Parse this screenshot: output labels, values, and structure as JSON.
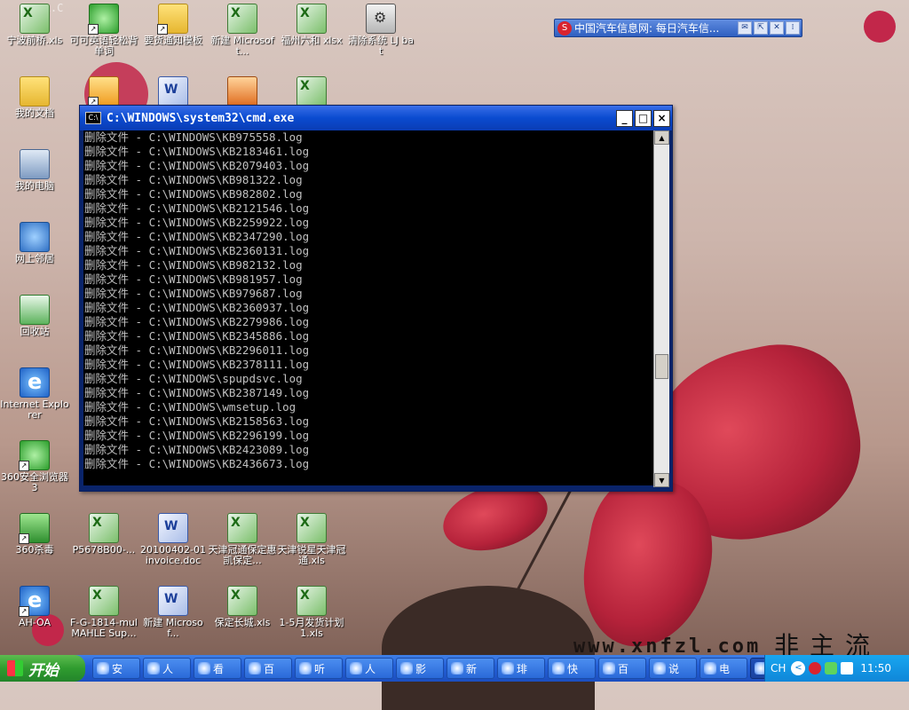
{
  "desktop": {
    "watermark_url": "www.xnfzl.com",
    "watermark_cjk": "非主流",
    "watermark_topleft": "WYRL.C",
    "icons": [
      {
        "label": "宁波前桥.xls",
        "icon": "excel-file-icon"
      },
      {
        "label": "可可英语轻松背单词",
        "icon": "app-shortcut-icon"
      },
      {
        "label": "要货通知模板",
        "icon": "folder-icon"
      },
      {
        "label": "新建 Microsoft...",
        "icon": "excel-file-icon"
      },
      {
        "label": "福州六和 xlsx",
        "icon": "excel-file-icon"
      },
      {
        "label": "清除系统 LJ bat",
        "icon": "batch-file-icon"
      },
      {
        "label": "我的文档",
        "icon": "my-documents-icon"
      },
      {
        "label": "我的电脑",
        "icon": "my-computer-icon"
      },
      {
        "label": "网上邻居",
        "icon": "network-icon"
      },
      {
        "label": "回收站",
        "icon": "recycle-bin-icon"
      },
      {
        "label": "Internet Explorer",
        "icon": "ie-icon"
      },
      {
        "label": "360安全浏览器 3",
        "icon": "browser-360-icon"
      },
      {
        "label": "360杀毒",
        "icon": "antivirus-360-icon"
      },
      {
        "label": "P5678B00-...",
        "icon": "excel-file-icon"
      },
      {
        "label": "20100402-01 invoice.doc",
        "icon": "word-file-icon"
      },
      {
        "label": "天津冠通保定惠凯保定...",
        "icon": "excel-file-icon"
      },
      {
        "label": "天津锐星天津冠通.xls",
        "icon": "excel-file-icon"
      },
      {
        "label": "AH-OA",
        "icon": "ie-shortcut-icon"
      },
      {
        "label": "F-G-1814-mul MAHLE Sup...",
        "icon": "excel-file-icon"
      },
      {
        "label": "新建 Microsof...",
        "icon": "word-file-icon"
      },
      {
        "label": "保定长城.xls",
        "icon": "excel-file-icon"
      },
      {
        "label": "1-5月发货计划1.xls",
        "icon": "excel-file-icon"
      }
    ]
  },
  "newsbar": {
    "text": "中国汽车信息网: 每日汽车信...",
    "icons": [
      "sogou-icon",
      "mail-icon",
      "restore-icon",
      "close-icon",
      "menu-icon"
    ]
  },
  "cmd_window": {
    "title": "C:\\WINDOWS\\system32\\cmd.exe",
    "buttons": {
      "minimize": "_",
      "maximize": "□",
      "close": "×"
    },
    "lines": [
      "删除文件 - C:\\WINDOWS\\KB975558.log",
      "删除文件 - C:\\WINDOWS\\KB2183461.log",
      "删除文件 - C:\\WINDOWS\\KB2079403.log",
      "删除文件 - C:\\WINDOWS\\KB981322.log",
      "删除文件 - C:\\WINDOWS\\KB982802.log",
      "删除文件 - C:\\WINDOWS\\KB2121546.log",
      "删除文件 - C:\\WINDOWS\\KB2259922.log",
      "删除文件 - C:\\WINDOWS\\KB2347290.log",
      "删除文件 - C:\\WINDOWS\\KB2360131.log",
      "删除文件 - C:\\WINDOWS\\KB982132.log",
      "删除文件 - C:\\WINDOWS\\KB981957.log",
      "删除文件 - C:\\WINDOWS\\KB979687.log",
      "删除文件 - C:\\WINDOWS\\KB2360937.log",
      "删除文件 - C:\\WINDOWS\\KB2279986.log",
      "删除文件 - C:\\WINDOWS\\KB2345886.log",
      "删除文件 - C:\\WINDOWS\\KB2296011.log",
      "删除文件 - C:\\WINDOWS\\KB2378111.log",
      "删除文件 - C:\\WINDOWS\\spupdsvc.log",
      "删除文件 - C:\\WINDOWS\\KB2387149.log",
      "删除文件 - C:\\WINDOWS\\wmsetup.log",
      "删除文件 - C:\\WINDOWS\\KB2158563.log",
      "删除文件 - C:\\WINDOWS\\KB2296199.log",
      "删除文件 - C:\\WINDOWS\\KB2423089.log",
      "删除文件 - C:\\WINDOWS\\KB2436673.log"
    ],
    "scroll_position": 0.69
  },
  "taskbar": {
    "start_label": "开始",
    "tasks": [
      "安",
      "人",
      "看",
      "百",
      "听",
      "人",
      "影",
      "新",
      "琲",
      "快",
      "百",
      "说",
      "电",
      "C..."
    ],
    "tray": {
      "language": "CH",
      "expand": "<",
      "clock": "11:50"
    }
  }
}
